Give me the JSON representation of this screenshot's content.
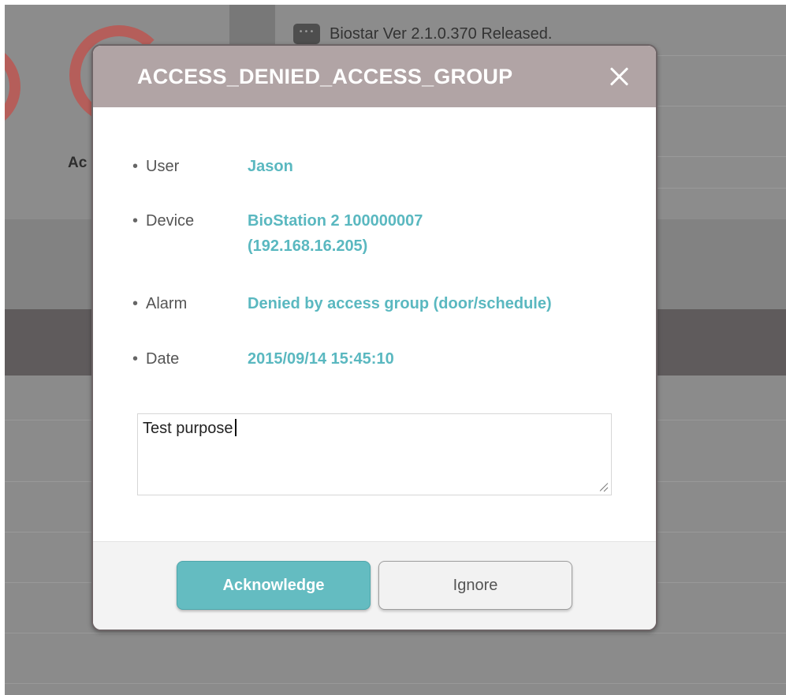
{
  "background": {
    "notice_text": "Biostar Ver 2.1.0.370 Released.",
    "notice_icon": "chat-bubble-icon",
    "gauge_label": "Ac"
  },
  "dialog": {
    "title": "ACCESS_DENIED_ACCESS_GROUP",
    "close_icon": "close-icon",
    "details": {
      "user": {
        "label": "User",
        "value": "Jason"
      },
      "device": {
        "label": "Device",
        "value_line1": "BioStation 2 100000007",
        "value_line2": "(192.168.16.205)"
      },
      "alarm": {
        "label": "Alarm",
        "value": "Denied by access group (door/schedule)"
      },
      "date": {
        "label": "Date",
        "value": "2015/09/14 15:45:10"
      }
    },
    "note": {
      "value": "Test purpose"
    },
    "buttons": {
      "acknowledge": "Acknowledge",
      "ignore": "Ignore"
    }
  },
  "colors": {
    "header": "#b1a4a5",
    "accent": "#5ab8c0",
    "primary_button": "#64bcc1",
    "gauge": "#b55e5a"
  }
}
